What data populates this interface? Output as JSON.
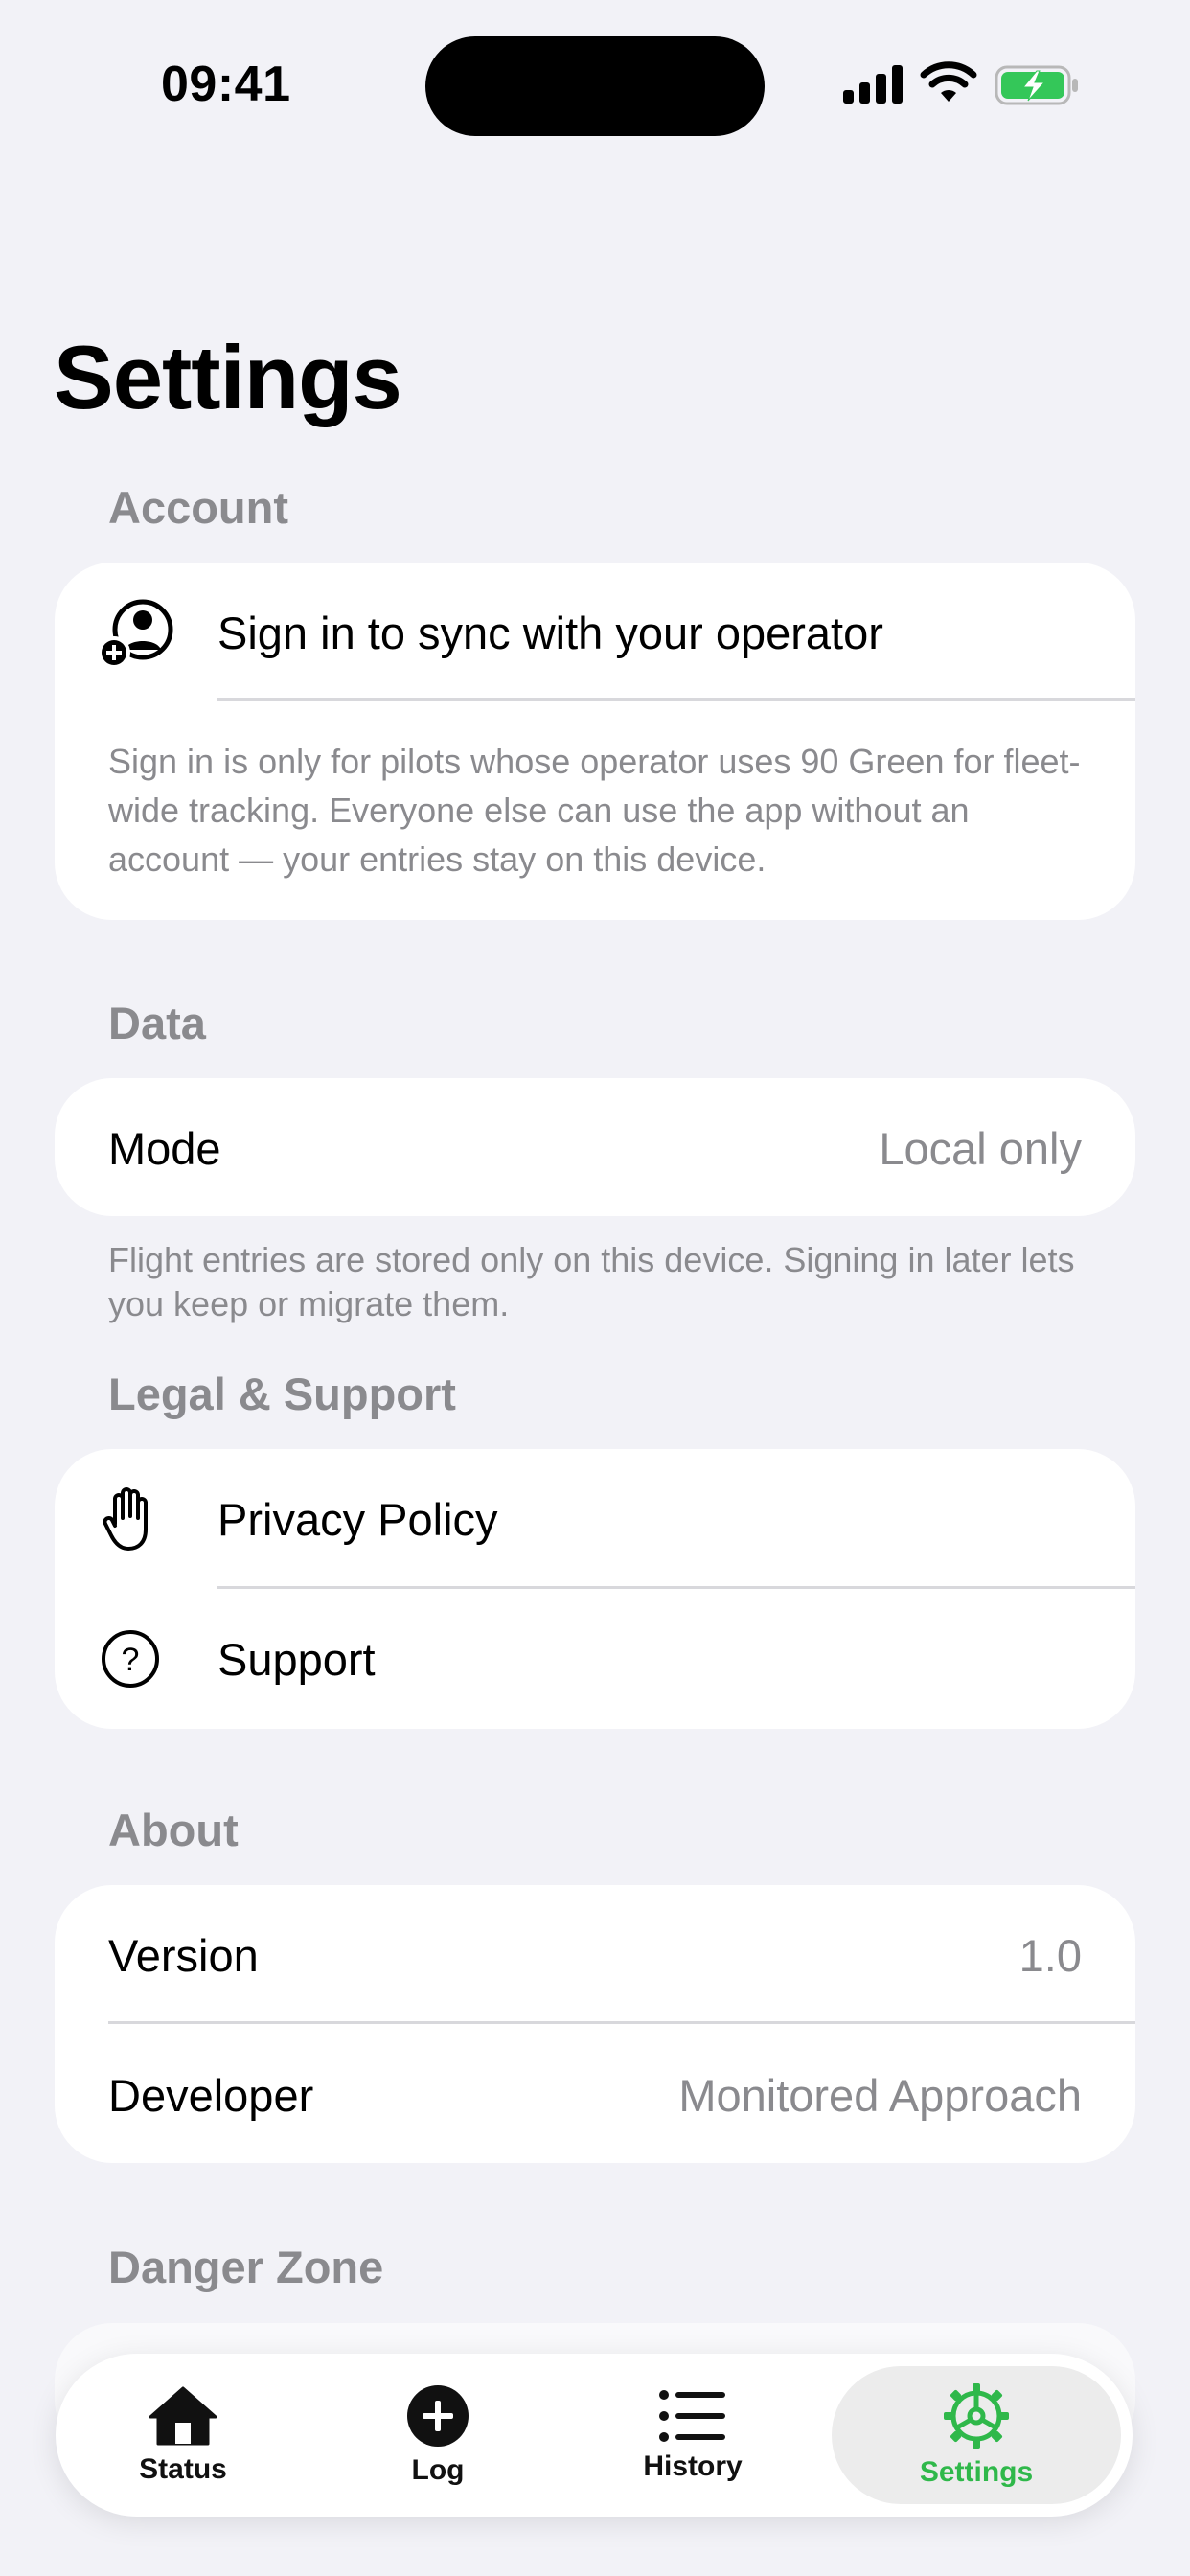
{
  "status_bar": {
    "time": "09:41"
  },
  "page": {
    "title": "Settings"
  },
  "sections": {
    "account": {
      "header": "Account",
      "sign_in_label": "Sign in to sync with your operator",
      "note": "Sign in is only for pilots whose operator uses 90 Green for fleet-wide tracking. Everyone else can use the app without an account — your entries stay on this device."
    },
    "data": {
      "header": "Data",
      "mode_label": "Mode",
      "mode_value": "Local only",
      "footnote": "Flight entries are stored only on this device. Signing in later lets you keep or migrate them."
    },
    "legal": {
      "header": "Legal & Support",
      "privacy_label": "Privacy Policy",
      "support_label": "Support"
    },
    "about": {
      "header": "About",
      "version_label": "Version",
      "version_value": "1.0",
      "developer_label": "Developer",
      "developer_value": "Monitored Approach"
    },
    "danger": {
      "header": "Danger Zone"
    }
  },
  "tab_bar": {
    "tabs": [
      {
        "label": "Status",
        "icon": "house-icon"
      },
      {
        "label": "Log",
        "icon": "plus-circle-icon"
      },
      {
        "label": "History",
        "icon": "list-icon"
      },
      {
        "label": "Settings",
        "icon": "gear-icon",
        "active": true
      }
    ]
  },
  "colors": {
    "accent": "#2fb84a",
    "secondary_text": "#8a8a8e",
    "background": "#f2f2f7"
  }
}
